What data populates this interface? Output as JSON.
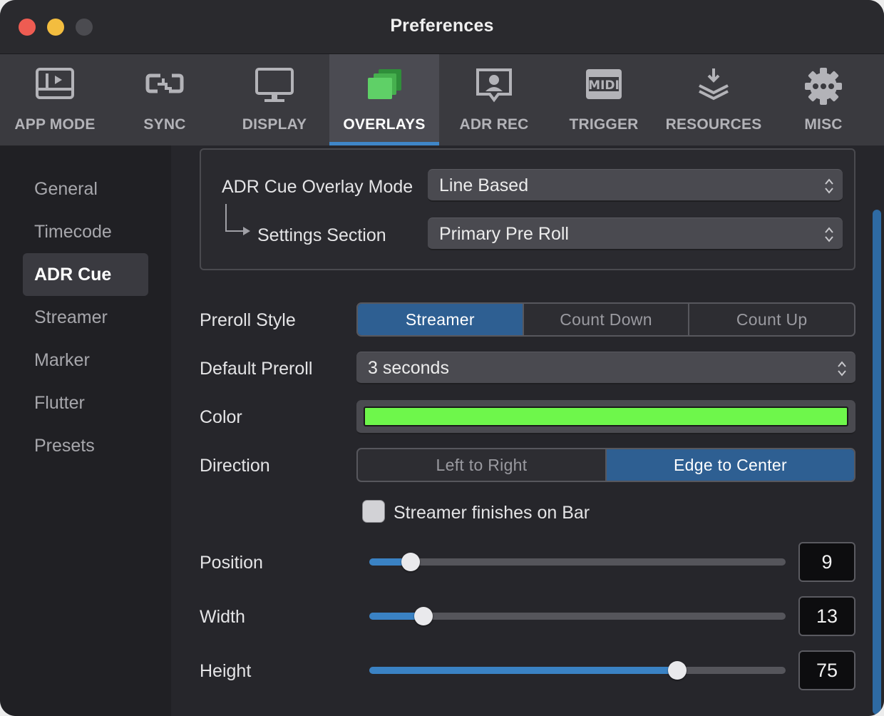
{
  "window": {
    "title": "Preferences"
  },
  "toolbar": {
    "items": [
      {
        "label": "APP MODE",
        "icon": "app-mode-icon"
      },
      {
        "label": "SYNC",
        "icon": "sync-icon"
      },
      {
        "label": "DISPLAY",
        "icon": "display-icon"
      },
      {
        "label": "OVERLAYS",
        "icon": "overlays-icon",
        "active": true
      },
      {
        "label": "ADR REC",
        "icon": "adr-rec-icon"
      },
      {
        "label": "TRIGGER",
        "icon": "midi-icon"
      },
      {
        "label": "RESOURCES",
        "icon": "resources-icon"
      },
      {
        "label": "MISC",
        "icon": "gear-icon"
      }
    ],
    "accent": "#3f86c8"
  },
  "sidebar": {
    "items": [
      {
        "label": "General"
      },
      {
        "label": "Timecode"
      },
      {
        "label": "ADR Cue",
        "active": true
      },
      {
        "label": "Streamer"
      },
      {
        "label": "Marker"
      },
      {
        "label": "Flutter"
      },
      {
        "label": "Presets"
      }
    ]
  },
  "overlay_box": {
    "mode_label": "ADR Cue Overlay Mode",
    "mode_value": "Line Based",
    "section_label": "Settings Section",
    "section_value": "Primary Pre Roll"
  },
  "preroll_style": {
    "label": "Preroll Style",
    "options": [
      "Streamer",
      "Count Down",
      "Count Up"
    ],
    "selected": "Streamer"
  },
  "default_preroll": {
    "label": "Default Preroll",
    "value": "3 seconds"
  },
  "color": {
    "label": "Color",
    "value": "#6ef74b"
  },
  "direction": {
    "label": "Direction",
    "options": [
      "Left to Right",
      "Edge to Center"
    ],
    "selected": "Edge to Center"
  },
  "finish_on_bar": {
    "label": "Streamer finishes on Bar",
    "checked": false
  },
  "sliders": [
    {
      "label": "Position",
      "value": "9",
      "fraction": 0.1
    },
    {
      "label": "Width",
      "value": "13",
      "fraction": 0.13
    },
    {
      "label": "Height",
      "value": "75",
      "fraction": 0.74
    }
  ],
  "colors": {
    "selected_segment": "#2e5f92",
    "slider_fill": "#3a82c4"
  }
}
